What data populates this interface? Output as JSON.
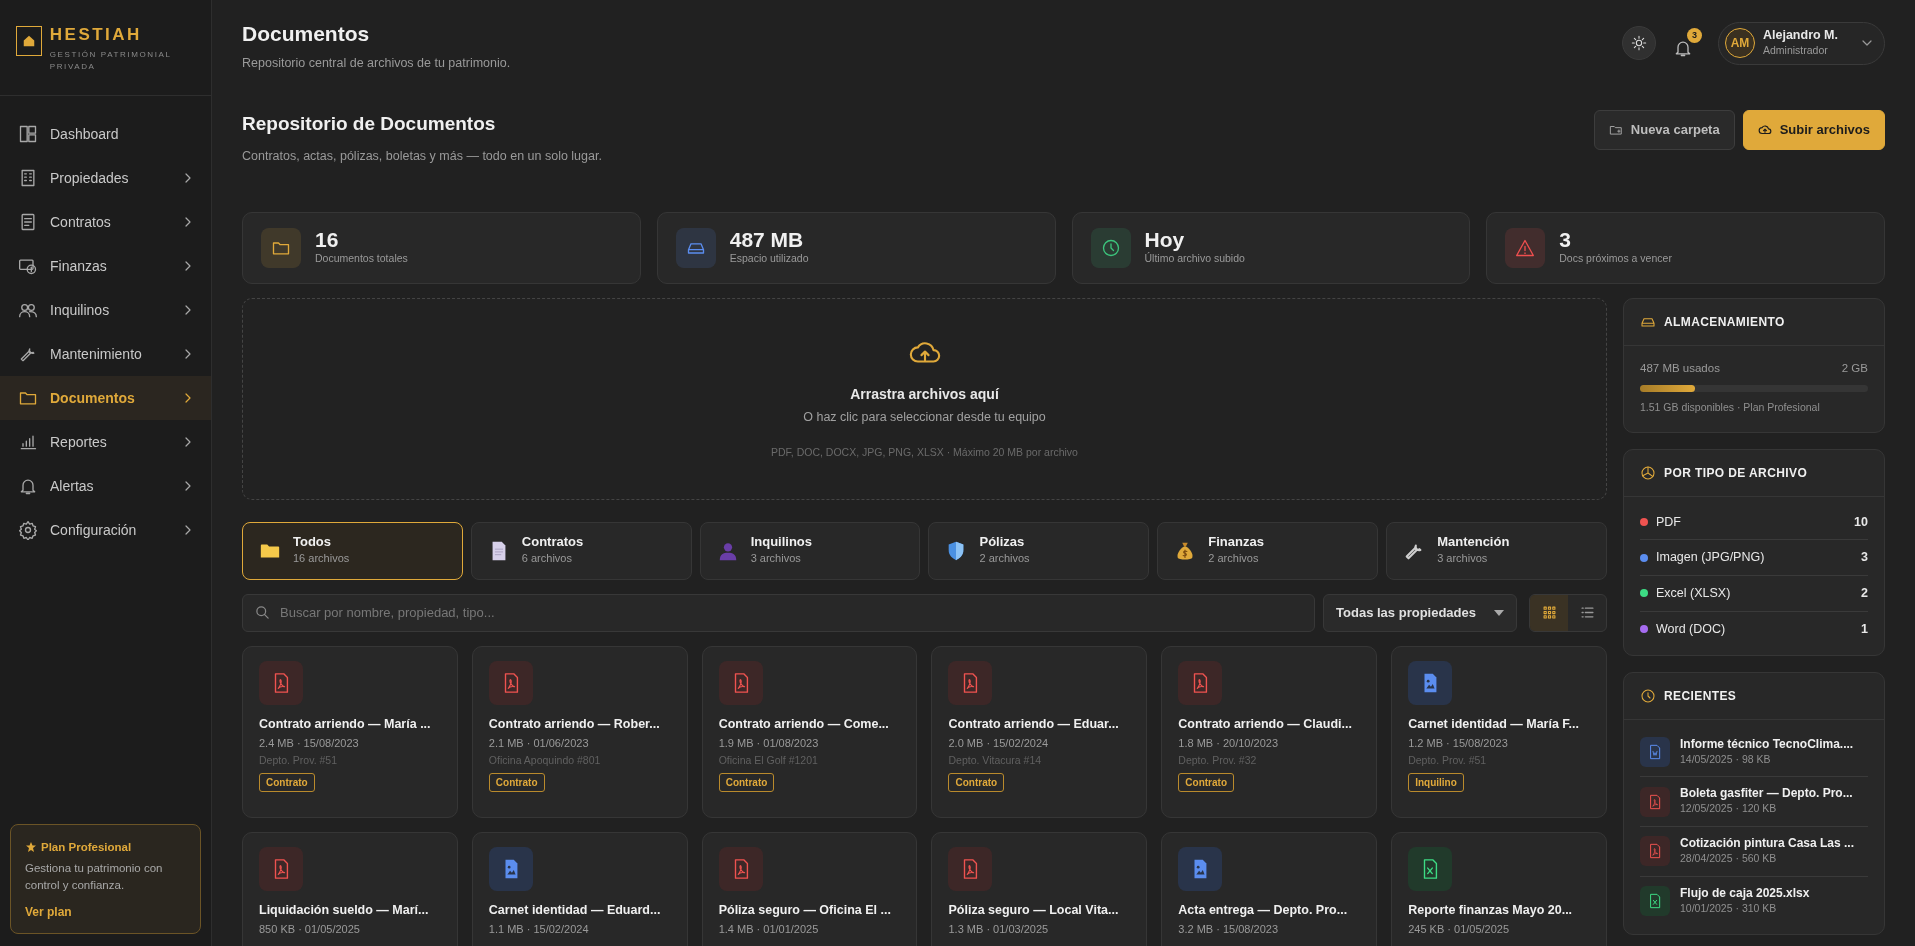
{
  "sidebar": {
    "brand": {
      "name": "HESTIAH",
      "tagline": "GESTIÓN PATRIMONIAL PRIVADA"
    },
    "items": [
      {
        "label": "Dashboard",
        "selected": false,
        "expandable": false
      },
      {
        "label": "Propiedades",
        "selected": false,
        "expandable": true
      },
      {
        "label": "Contratos",
        "selected": false,
        "expandable": true
      },
      {
        "label": "Finanzas",
        "selected": false,
        "expandable": true
      },
      {
        "label": "Inquilinos",
        "selected": false,
        "expandable": true
      },
      {
        "label": "Mantenimiento",
        "selected": false,
        "expandable": true
      },
      {
        "label": "Documentos",
        "selected": true,
        "expandable": true
      },
      {
        "label": "Reportes",
        "selected": false,
        "expandable": true
      },
      {
        "label": "Alertas",
        "selected": false,
        "expandable": true
      },
      {
        "label": "Configuración",
        "selected": false,
        "expandable": true
      }
    ],
    "plan": {
      "title": "Plan Profesional",
      "text": "Gestiona tu patrimonio con control y confianza.",
      "link": "Ver plan"
    }
  },
  "header": {
    "title": "Documentos",
    "subtitle": "Repositorio central de archivos de tu patrimonio.",
    "notifications": "3",
    "user": {
      "initials": "AM",
      "name": "Alejandro M.",
      "role": "Administrador"
    }
  },
  "section": {
    "title": "Repositorio de Documentos",
    "subtitle": "Contratos, actas, pólizas, boletas y más — todo en un solo lugar.",
    "buttons": [
      {
        "label": "Nueva carpeta",
        "kind": "secondary"
      },
      {
        "label": "Subir archivos",
        "kind": "primary"
      }
    ]
  },
  "stats": [
    {
      "value": "16",
      "label": "Documentos totales",
      "color": "#e0a93a"
    },
    {
      "value": "487 MB",
      "label": "Espacio utilizado",
      "color": "#5b8def"
    },
    {
      "value": "Hoy",
      "label": "Último archivo subido",
      "color": "#3cc47c"
    },
    {
      "value": "3",
      "label": "Docs próximos a vencer",
      "color": "#ef4f4f"
    }
  ],
  "dropzone": {
    "title": "Arrastra archivos aquí",
    "subtitle": "O haz clic para seleccionar desde tu equipo",
    "note": "PDF, DOC, DOCX, JPG, PNG, XLSX · Máximo 20 MB por archivo"
  },
  "categories": [
    {
      "label": "Todos",
      "count": "16 archivos",
      "selected": true
    },
    {
      "label": "Contratos",
      "count": "6 archivos",
      "selected": false
    },
    {
      "label": "Inquilinos",
      "count": "3 archivos",
      "selected": false
    },
    {
      "label": "Pólizas",
      "count": "2 archivos",
      "selected": false
    },
    {
      "label": "Finanzas",
      "count": "2 archivos",
      "selected": false
    },
    {
      "label": "Mantención",
      "count": "3 archivos",
      "selected": false
    }
  ],
  "search": {
    "placeholder": "Buscar por nombre, propiedad, tipo..."
  },
  "filter": {
    "value": "Todas las propiedades"
  },
  "views": [
    {
      "kind": "grid",
      "selected": true
    },
    {
      "kind": "list",
      "selected": false
    }
  ],
  "documents": [
    {
      "kind": "pdf",
      "name": "Contrato arriendo — María ...",
      "meta": "2.4 MB · 15/08/2023",
      "location": "Depto. Prov. #51",
      "tag": "Contrato"
    },
    {
      "kind": "pdf",
      "name": "Contrato arriendo — Rober...",
      "meta": "2.1 MB · 01/06/2023",
      "location": "Oficina Apoquindo #801",
      "tag": "Contrato"
    },
    {
      "kind": "pdf",
      "name": "Contrato arriendo — Come...",
      "meta": "1.9 MB · 01/08/2023",
      "location": "Oficina El Golf #1201",
      "tag": "Contrato"
    },
    {
      "kind": "pdf",
      "name": "Contrato arriendo — Eduar...",
      "meta": "2.0 MB · 15/02/2024",
      "location": "Depto. Vitacura #14",
      "tag": "Contrato"
    },
    {
      "kind": "pdf",
      "name": "Contrato arriendo — Claudi...",
      "meta": "1.8 MB · 20/10/2023",
      "location": "Depto. Prov. #32",
      "tag": "Contrato"
    },
    {
      "kind": "image",
      "name": "Carnet identidad — María F...",
      "meta": "1.2 MB · 15/08/2023",
      "location": "Depto. Prov. #51",
      "tag": "Inquilino"
    },
    {
      "kind": "pdf",
      "name": "Liquidación sueldo — Marí...",
      "meta": "850 KB · 01/05/2025"
    },
    {
      "kind": "image",
      "name": "Carnet identidad — Eduard...",
      "meta": "1.1 MB · 15/02/2024"
    },
    {
      "kind": "pdf",
      "name": "Póliza seguro — Oficina El ...",
      "meta": "1.4 MB · 01/01/2025"
    },
    {
      "kind": "pdf",
      "name": "Póliza seguro — Local Vita...",
      "meta": "1.3 MB · 01/03/2025"
    },
    {
      "kind": "image",
      "name": "Acta entrega — Depto. Pro...",
      "meta": "3.2 MB · 15/08/2023"
    },
    {
      "kind": "excel",
      "name": "Reporte finanzas Mayo 20...",
      "meta": "245 KB · 01/05/2025"
    }
  ],
  "storage": {
    "title": "ALMACENAMIENTO",
    "used": "487 MB usados",
    "total": "2 GB",
    "level": 0.24,
    "note": "1.51 GB disponibles · Plan Profesional"
  },
  "file_types": {
    "title": "POR TIPO DE ARCHIVO",
    "items": [
      {
        "label": "PDF",
        "count": "10",
        "color": "#ef5350"
      },
      {
        "label": "Imagen (JPG/PNG)",
        "count": "3",
        "color": "#5b8def"
      },
      {
        "label": "Excel (XLSX)",
        "count": "2",
        "color": "#3ddc84"
      },
      {
        "label": "Word (DOC)",
        "count": "1",
        "color": "#a66cf0"
      }
    ]
  },
  "recents": {
    "title": "RECIENTES",
    "items": [
      {
        "kind": "word",
        "name": "Informe técnico TecnoClima....",
        "meta": "14/05/2025 · 98 KB"
      },
      {
        "kind": "pdf",
        "name": "Boleta gasfiter — Depto. Pro...",
        "meta": "12/05/2025 · 120 KB"
      },
      {
        "kind": "pdf",
        "name": "Cotización pintura Casa Las ...",
        "meta": "28/04/2025 · 560 KB"
      },
      {
        "kind": "excel",
        "name": "Flujo de caja 2025.xlsx",
        "meta": "10/01/2025 · 310 KB"
      }
    ]
  }
}
